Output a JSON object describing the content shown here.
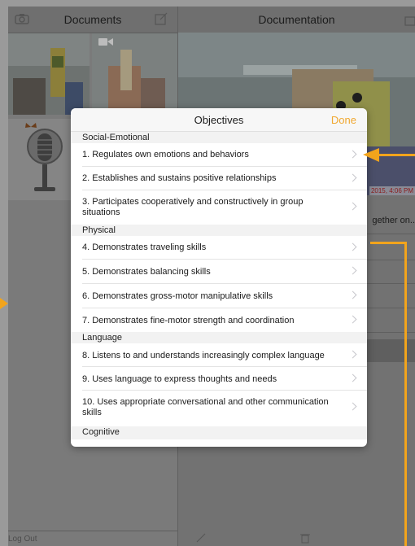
{
  "left_pane": {
    "title": "Documents",
    "footer_label": "Log Out"
  },
  "right_pane": {
    "title": "Documentation",
    "date_text": "2015, 4:06 PM",
    "truncated_text": "gether on.."
  },
  "popover": {
    "title": "Objectives",
    "done_label": "Done",
    "sections": [
      {
        "label": "Social-Emotional",
        "items": [
          "1. Regulates own emotions and behaviors",
          "2. Establishes and sustains positive relationships",
          "3. Participates cooperatively and constructively in group situations"
        ]
      },
      {
        "label": "Physical",
        "items": [
          "4. Demonstrates traveling skills",
          "5. Demonstrates balancing skills",
          "6. Demonstrates gross-motor manipulative skills",
          "7. Demonstrates fine-motor strength and coordination"
        ]
      },
      {
        "label": "Language",
        "items": [
          "8. Listens to and understands increasingly complex language",
          "9. Uses language to express thoughts and needs",
          "10. Uses appropriate conversational and other communication skills"
        ]
      },
      {
        "label": "Cognitive",
        "items": []
      }
    ]
  },
  "colors": {
    "accent": "#f0a830",
    "annotation": "#f2a41c"
  },
  "icons": [
    "camera-icon",
    "compose-icon",
    "video-icon",
    "butterfly-icon",
    "microphone-icon",
    "chevron-right-icon",
    "share-icon",
    "trash-icon"
  ]
}
